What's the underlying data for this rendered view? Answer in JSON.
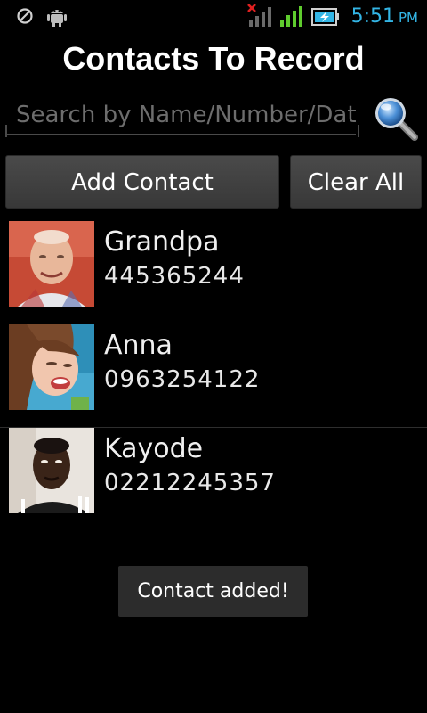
{
  "status_bar": {
    "time": "5:51",
    "ampm": "PM",
    "icons": [
      "sync-off-icon",
      "android-debug-icon",
      "no-signal-icon",
      "signal-strength-icon",
      "battery-charging-icon"
    ],
    "accent_color": "#33b5e5"
  },
  "header": {
    "title": "Contacts To Record"
  },
  "search": {
    "placeholder": "Search by Name/Number/Date",
    "value": "",
    "icon": "magnifier-icon"
  },
  "buttons": {
    "add_label": "Add Contact",
    "clear_label": "Clear All"
  },
  "contacts": [
    {
      "name": "Grandpa",
      "number": "445365244",
      "avatar": "elderly-man-photo"
    },
    {
      "name": "Anna",
      "number": "0963254122",
      "avatar": "young-woman-photo"
    },
    {
      "name": "Kayode",
      "number": "02212245357",
      "avatar": "young-man-photo"
    }
  ],
  "toast": {
    "message": "Contact added!"
  }
}
